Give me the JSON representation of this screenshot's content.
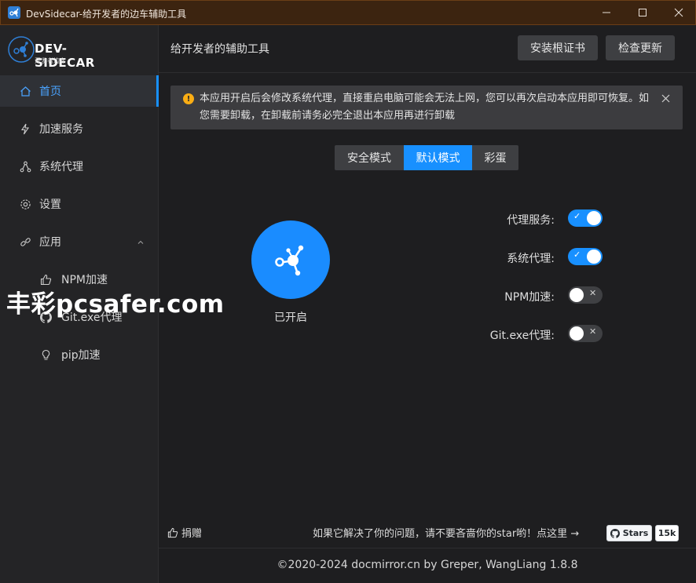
{
  "window": {
    "title": "DevSidecar-给开发者的边车辅助工具"
  },
  "logo": {
    "main": "DEV-SIDECAR",
    "sub": "开发者边车"
  },
  "sidebar": {
    "items": [
      {
        "label": "首页",
        "icon": "home-icon",
        "active": true
      },
      {
        "label": "加速服务",
        "icon": "thunder-icon"
      },
      {
        "label": "系统代理",
        "icon": "network-icon"
      },
      {
        "label": "设置",
        "icon": "gear-icon"
      },
      {
        "label": "应用",
        "icon": "link-icon",
        "expanded": true
      },
      {
        "label": "NPM加速",
        "icon": "thumbs-up-icon"
      },
      {
        "label": "Git.exe代理",
        "icon": "github-icon"
      },
      {
        "label": "pip加速",
        "icon": "bulb-icon"
      }
    ]
  },
  "header": {
    "title": "给开发者的辅助工具",
    "install_cert": "安装根证书",
    "check_update": "检查更新"
  },
  "alert": {
    "text": "本应用开启后会修改系统代理，直接重启电脑可能会无法上网，您可以再次启动本应用即可恢复。如您需要卸载，在卸载前请务必完全退出本应用再进行卸载"
  },
  "mode_tabs": [
    {
      "label": "安全模式"
    },
    {
      "label": "默认模式",
      "active": true
    },
    {
      "label": "彩蛋"
    }
  ],
  "status": {
    "label": "已开启"
  },
  "switches": [
    {
      "label": "代理服务:",
      "on": true
    },
    {
      "label": "系统代理:",
      "on": true
    },
    {
      "label": "NPM加速:",
      "on": false
    },
    {
      "label": "Git.exe代理:",
      "on": false
    }
  ],
  "watermark": "丰彩pcsafer.com",
  "footer": {
    "donate": "捐赠",
    "star_prompt": "如果它解决了你的问题，请不要吝啬你的star哟！点这里 →",
    "stars_label": "Stars",
    "stars_count": "15k",
    "copyright": "©2020-2024 docmirror.cn by Greper, WangLiang 1.8.8"
  },
  "colors": {
    "accent": "#1890ff",
    "titlebar": "#3c2410",
    "warning": "#faad14"
  }
}
